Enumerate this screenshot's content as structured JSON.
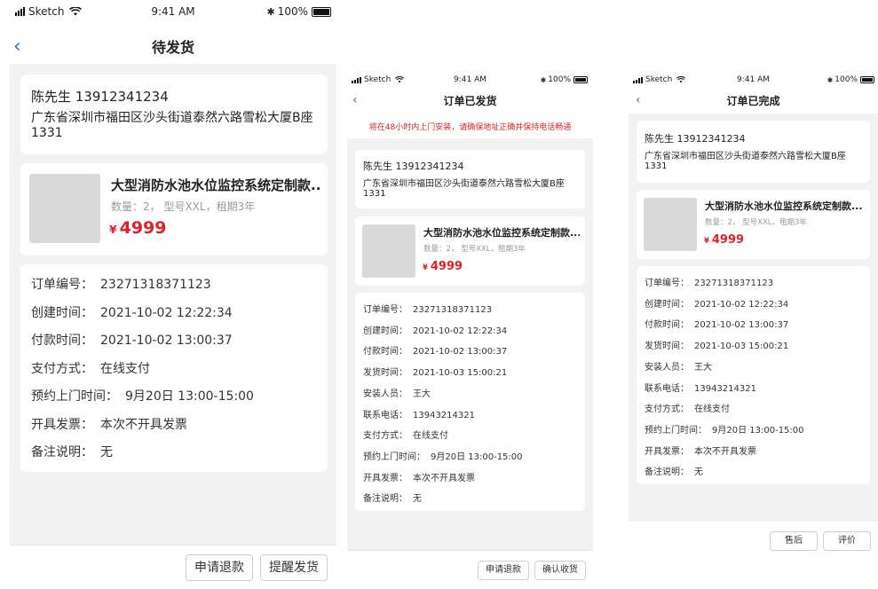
{
  "colors": {
    "accent_blue": "#2f6de1",
    "price_red": "#e0202a",
    "page_bg": "#f2f2f2",
    "card_bg": "#ffffff",
    "thumb_gray": "#d9d9d9"
  },
  "status_bar": {
    "carrier": "Sketch",
    "time": "9:41 AM",
    "battery": "100%",
    "battery_level": 1.0,
    "icons": [
      "signal-icon",
      "wifi-icon",
      "bluetooth-icon",
      "battery-icon"
    ]
  },
  "screens": [
    {
      "title": "待发货",
      "back_icon": "‹",
      "address": {
        "name_phone": "陈先生  13912341234",
        "line1": "广东省深圳市福田区沙头街道泰然六路雪松大厦B座",
        "line2": "1331"
      },
      "product": {
        "title": "大型消防水池水位监控系统定制款...",
        "meta": "数量：2， 型号XXL，租期3年",
        "currency": "¥",
        "price": "4999"
      },
      "details": [
        {
          "label": "订单编号：",
          "value": "23271318371123"
        },
        {
          "label": "创建时间：",
          "value": "2021-10-02 12:22:34"
        },
        {
          "label": "付款时间：",
          "value": "2021-10-02 13:00:37"
        },
        {
          "label": "支付方式：",
          "value": "在线支付"
        },
        {
          "label": "预约上门时间：",
          "value": "9月20日 13:00-15:00"
        },
        {
          "label": "开具发票：",
          "value": "本次不开具发票"
        },
        {
          "label": "备注说明：",
          "value": "无"
        }
      ],
      "buttons": [
        "申请退款",
        "提醒发货"
      ]
    },
    {
      "title": "订单已发货",
      "back_icon": "‹",
      "notice": "将在48小时内上门安装，请确保地址正确并保持电话畅通",
      "address": {
        "name_phone": "陈先生  13912341234",
        "line1": "广东省深圳市福田区沙头街道泰然六路雪松大厦B座",
        "line2": "1331"
      },
      "product": {
        "title": "大型消防水池水位监控系统定制款...",
        "meta": "数量：2， 型号XXL，租期3年",
        "currency": "¥",
        "price": "4999"
      },
      "details": [
        {
          "label": "订单编号：",
          "value": "23271318371123"
        },
        {
          "label": "创建时间：",
          "value": "2021-10-02 12:22:34"
        },
        {
          "label": "付款时间：",
          "value": "2021-10-02 13:00:37"
        },
        {
          "label": "发货时间：",
          "value": "2021-10-03 15:00:21"
        },
        {
          "label": "安装人员：",
          "value": "王大"
        },
        {
          "label": "联系电话：",
          "value": "13943214321"
        },
        {
          "label": "支付方式：",
          "value": "在线支付"
        },
        {
          "label": "预约上门时间：",
          "value": "9月20日 13:00-15:00"
        },
        {
          "label": "开具发票：",
          "value": "本次不开具发票"
        },
        {
          "label": "备注说明：",
          "value": "无"
        }
      ],
      "buttons": [
        "申请退款",
        "确认收货"
      ]
    },
    {
      "title": "订单已完成",
      "back_icon": "‹",
      "address": {
        "name_phone": "陈先生  13912341234",
        "line1": "广东省深圳市福田区沙头街道泰然六路雪松大厦B座",
        "line2": "1331"
      },
      "product": {
        "title": "大型消防水池水位监控系统定制款...",
        "meta": "数量：2， 型号XXL，租期3年",
        "currency": "¥",
        "price": "4999"
      },
      "details": [
        {
          "label": "订单编号：",
          "value": "23271318371123"
        },
        {
          "label": "创建时间：",
          "value": "2021-10-02 12:22:34"
        },
        {
          "label": "付款时间：",
          "value": "2021-10-02 13:00:37"
        },
        {
          "label": "发货时间：",
          "value": "2021-10-03 15:00:21"
        },
        {
          "label": "安装人员：",
          "value": "王大"
        },
        {
          "label": "联系电话：",
          "value": "13943214321"
        },
        {
          "label": "支付方式：",
          "value": "在线支付"
        },
        {
          "label": "预约上门时间：",
          "value": "9月20日 13:00-15:00"
        },
        {
          "label": "开具发票：",
          "value": "本次不开具发票"
        },
        {
          "label": "备注说明：",
          "value": "无"
        }
      ],
      "buttons": [
        "售后",
        "评价"
      ]
    }
  ]
}
